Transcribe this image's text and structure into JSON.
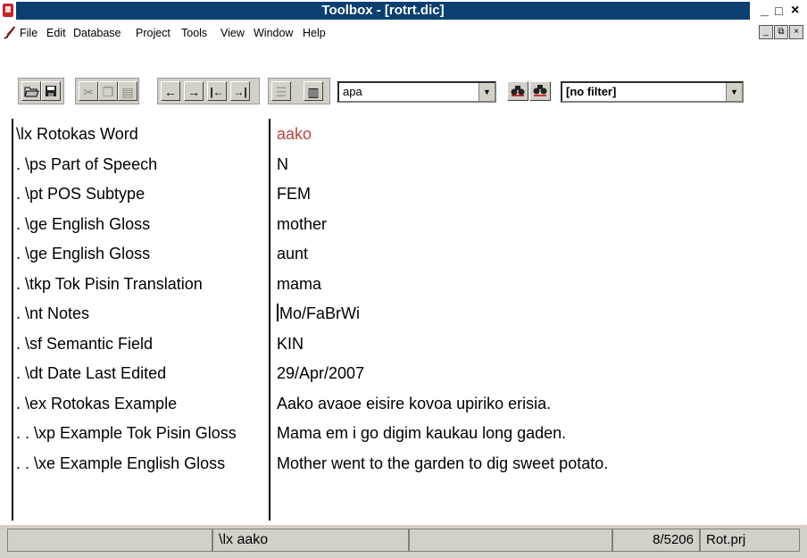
{
  "window": {
    "title": "Toolbox - [rotrt.dic]",
    "controls": [
      "_",
      "□",
      "×"
    ]
  },
  "menu": {
    "items": [
      "File",
      "Edit",
      "Database",
      "Project",
      "Tools",
      "View",
      "Window",
      "Help"
    ],
    "mdi_controls": [
      "_",
      "⧉",
      "×"
    ]
  },
  "toolbar": {
    "icons": [
      "open-icon",
      "save-icon",
      "cut-icon",
      "copy-icon",
      "paste-icon",
      "arrow-left-icon",
      "arrow-right-icon",
      "first-icon",
      "last-icon",
      "browse-icon",
      "table-icon",
      "find-icon",
      "find-next-icon"
    ],
    "arrows": [
      "←",
      "→",
      "|←",
      "→|"
    ],
    "search_value": "apa",
    "filter_value": "[no filter]"
  },
  "record": {
    "labels": [
      "\\lx  Rotokas Word",
      ". \\ps  Part of Speech",
      ". \\pt  POS Subtype",
      ". \\ge  English Gloss",
      ". \\ge  English Gloss",
      ". \\tkp  Tok Pisin Translation",
      ". \\nt  Notes",
      ". \\sf  Semantic Field",
      ". \\dt  Date Last Edited",
      ". \\ex  Rotokas Example",
      ". . \\xp  Example Tok Pisin Gloss",
      ". . \\xe  Example English Gloss"
    ],
    "values": [
      "aako",
      "N",
      "FEM",
      "mother",
      "aunt",
      "mama",
      "Mo/FaBrWi",
      "KIN",
      "29/Apr/2007",
      "Aako avaoe eisire kovoa upiriko erisia.",
      "Mama em i go digim kaukau long gaden.",
      "Mother went to the garden to dig sweet potato."
    ]
  },
  "status": {
    "cell1": "",
    "current_field": "\\lx aako",
    "cell3": "",
    "record_count": "8/5206",
    "project": "Rot.prj"
  },
  "colors": {
    "titlebar": "#0b3f70",
    "headword": "#b2463d",
    "chrome": "#d4d0c8"
  }
}
